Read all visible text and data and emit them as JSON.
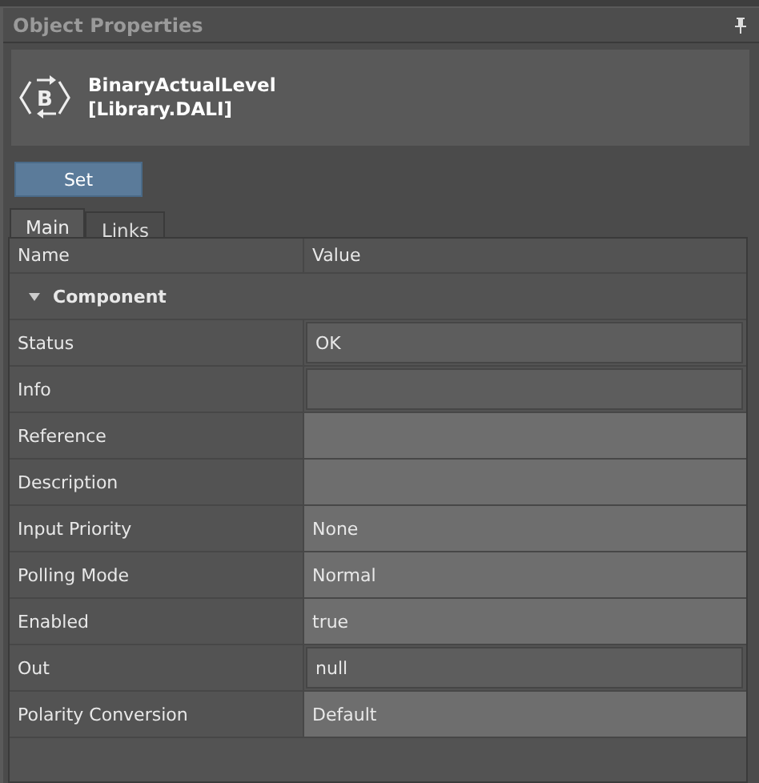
{
  "panel": {
    "title": "Object Properties"
  },
  "object": {
    "icon_letter": "B",
    "name": "BinaryActualLevel",
    "library": "[Library.DALI]"
  },
  "set_button": "Set",
  "tabs": [
    {
      "label": "Main",
      "selected": true
    },
    {
      "label": "Links",
      "selected": false
    }
  ],
  "table": {
    "columns": [
      "Name",
      "Value"
    ],
    "group": {
      "label": "Component",
      "expanded": true
    },
    "rows": [
      {
        "name": "Status",
        "value": "OK",
        "editable": false
      },
      {
        "name": "Info",
        "value": "",
        "editable": false
      },
      {
        "name": "Reference",
        "value": "",
        "editable": true
      },
      {
        "name": "Description",
        "value": "",
        "editable": true
      },
      {
        "name": "Input Priority",
        "value": "None",
        "editable": true
      },
      {
        "name": "Polling Mode",
        "value": "Normal",
        "editable": true
      },
      {
        "name": "Enabled",
        "value": "true",
        "editable": true
      },
      {
        "name": "Out",
        "value": "null",
        "editable": false
      },
      {
        "name": "Polarity Conversion",
        "value": "Default",
        "editable": true
      }
    ]
  }
}
